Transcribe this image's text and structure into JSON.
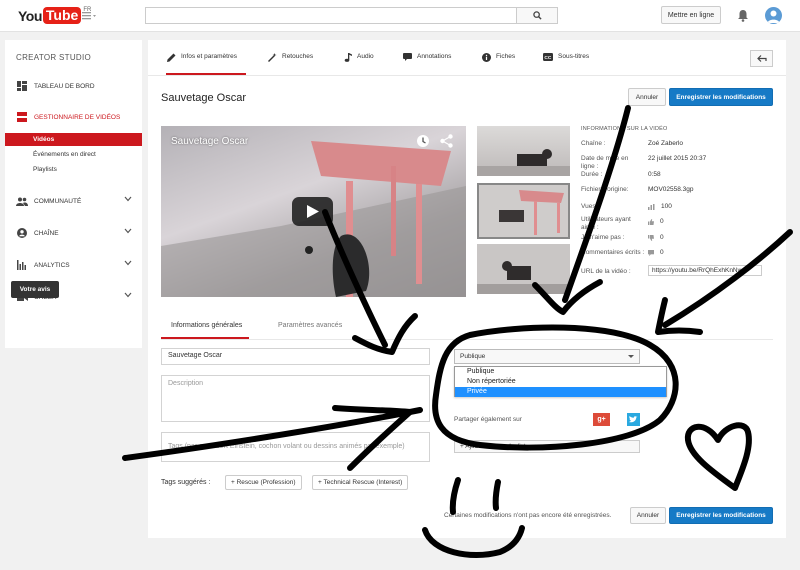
{
  "header": {
    "logo_you": "You",
    "logo_tube": "Tube",
    "region": "FR",
    "upload_label": "Mettre en ligne"
  },
  "sidebar": {
    "title": "CREATOR STUDIO",
    "dashboard": "TABLEAU DE BORD",
    "video_manager": "GESTIONNAIRE DE VIDÉOS",
    "sub": [
      "Vidéos",
      "Événements en direct",
      "Playlists"
    ],
    "community": "COMMUNAUTÉ",
    "channel": "CHAÎNE",
    "analytics": "ANALYTICS",
    "create": "CRÉER",
    "feedback": "Votre avis"
  },
  "tabs": [
    "Infos et paramètres",
    "Retouches",
    "Audio",
    "Annotations",
    "Fiches",
    "Sous-titres"
  ],
  "editor": {
    "title": "Sauvetage Oscar",
    "cancel": "Annuler",
    "save": "Enregistrer les modifications",
    "player_title": "Sauvetage Oscar"
  },
  "info": {
    "heading": "INFORMATIONS SUR LA VIDÉO",
    "channel_label": "Chaîne :",
    "channel_value": "Zoé Zaberlo",
    "date_label": "Date de mise en ligne :",
    "date_value": "22 juillet 2015 20:37",
    "duration_label": "Durée :",
    "duration_value": "0:58",
    "file_label": "Fichier d'origine:",
    "file_value": "MOV02558.3gp",
    "views_label": "Vues :",
    "views_value": "100",
    "likes_label": "Utilisateurs ayant aimé :",
    "likes_value": "0",
    "dislikes_label": "Je n'aime pas :",
    "dislikes_value": "0",
    "comments_label": "Commentaires écrits :",
    "comments_value": "0",
    "url_label": "URL de la vidéo :",
    "url_value": "https://youtu.be/RrQhExhKnNw"
  },
  "form": {
    "subtab_general": "Informations générales",
    "subtab_advanced": "Paramètres avancés",
    "title_value": "Sauvetage Oscar",
    "description_placeholder": "Description",
    "tags_placeholder": "Tags (par ex. albert Einstein, cochon volant ou dessins animés par exemple)",
    "privacy_selected": "Publique",
    "privacy_options": [
      "Publique",
      "Non répertoriée",
      "Privée"
    ],
    "share_label": "Partager également sur",
    "playlist_button": "+ Ajouter à une playlist",
    "suggested_label": "Tags suggérés :",
    "suggested_tags": [
      "+ Rescue (Profession)",
      "+ Technical Rescue (Interest)"
    ],
    "unsaved_notice": "Certaines modifications n'ont pas encore été enregistrées.",
    "cancel": "Annuler",
    "save": "Enregistrer les modifications"
  },
  "colors": {
    "accent_red": "#cc181e",
    "primary_blue": "#167ac6",
    "dropdown_selected": "#1e90ff"
  }
}
